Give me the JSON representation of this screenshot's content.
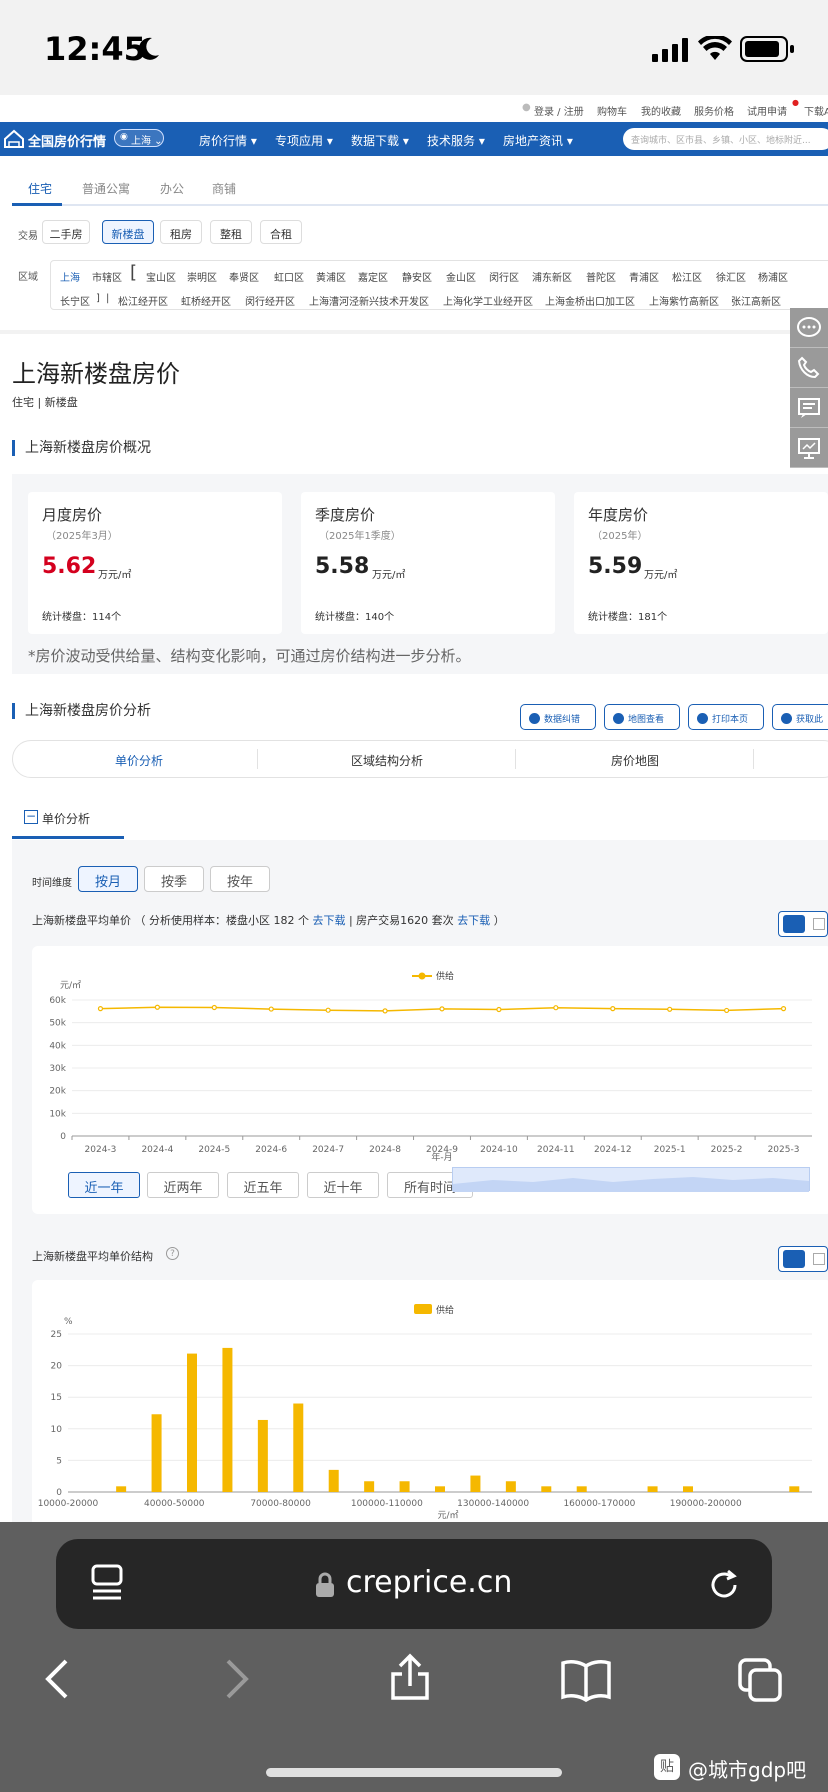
{
  "status_bar": {
    "time": "12:45"
  },
  "top_links": [
    "登录 / 注册",
    "购物车",
    "我的收藏",
    "服务价格",
    "试用申请",
    "下载A"
  ],
  "nav": {
    "logo": "全国房价行情",
    "city": "上海",
    "items": [
      "房价行情",
      "专项应用",
      "数据下载",
      "技术服务",
      "房地产资讯"
    ],
    "search_placeholder": "查询城市、区市县、乡镇、小区、地标附近..."
  },
  "property_tabs": [
    "住宅",
    "普通公寓",
    "办公",
    "商铺"
  ],
  "trade": {
    "label": "交易",
    "options": [
      "二手房",
      "新楼盘",
      "租房",
      "整租",
      "合租"
    ],
    "active": "新楼盘"
  },
  "region": {
    "label": "区域",
    "row1": [
      "上海",
      "市辖区",
      "[",
      "宝山区",
      "崇明区",
      "奉贤区",
      "虹口区",
      "黄浦区",
      "嘉定区",
      "静安区",
      "金山区",
      "闵行区",
      "浦东新区",
      "普陀区",
      "青浦区",
      "松江区",
      "徐汇区",
      "杨浦区"
    ],
    "row2": [
      "长宁区",
      "]",
      "|",
      "松江经开区",
      "虹桥经开区",
      "闵行经开区",
      "上海漕河泾新兴技术开发区",
      "上海化学工业经开区",
      "上海金桥出口加工区",
      "上海紫竹高新区",
      "张江高新区"
    ]
  },
  "page": {
    "title": "上海新楼盘房价",
    "crumb": "住宅 | 新楼盘"
  },
  "overview": {
    "title": "上海新楼盘房价概况",
    "cards": [
      {
        "title": "月度房价",
        "period": "（2025年3月）",
        "value": "5.62",
        "unit": "万元/㎡",
        "count": "统计楼盘：114个",
        "color": "#d4001e"
      },
      {
        "title": "季度房价",
        "period": "（2025年1季度）",
        "value": "5.58",
        "unit": "万元/㎡",
        "count": "统计楼盘：140个",
        "color": "#222222"
      },
      {
        "title": "年度房价",
        "period": "（2025年）",
        "value": "5.59",
        "unit": "万元/㎡",
        "count": "统计楼盘：181个",
        "color": "#222222"
      }
    ],
    "note": "*房价波动受供给量、结构变化影响，可通过房价结构进一步分析。"
  },
  "analysis": {
    "title": "上海新楼盘房价分析",
    "buttons": [
      "数据纠错",
      "地图查看",
      "打印本页",
      "获取此"
    ],
    "segments": [
      "单价分析",
      "区域结构分析",
      "房价地图"
    ],
    "sub_title": "单价分析",
    "time_label": "时间维度",
    "time_options": [
      "按月",
      "按季",
      "按年"
    ],
    "avg_caption": {
      "pre": "上海新楼盘平均单价 （ 分析使用样本：楼盘小区 182 个",
      "link1": "去下载",
      "mid": "| 房产交易1620 套次",
      "link2": "去下载",
      "post": "）"
    },
    "range_options": [
      "近一年",
      "近两年",
      "近五年",
      "近十年",
      "所有时间"
    ],
    "struct_caption": "上海新楼盘平均单价结构"
  },
  "chart_data": [
    {
      "type": "line",
      "ylabel": "元/㎡",
      "xlabel": "年-月",
      "legend": "供给",
      "legend_position": "top-center",
      "grid": true,
      "ylim": [
        0,
        60000
      ],
      "yticks": [
        "0",
        "10k",
        "20k",
        "30k",
        "40k",
        "50k",
        "60k"
      ],
      "categories": [
        "2024-3",
        "2024-4",
        "2024-5",
        "2024-6",
        "2024-7",
        "2024-8",
        "2024-9",
        "2024-10",
        "2024-11",
        "2024-12",
        "2025-1",
        "2025-2",
        "2025-3"
      ],
      "series": [
        {
          "name": "供给",
          "values": [
            56200,
            56800,
            56700,
            56000,
            55500,
            55200,
            56100,
            55800,
            56600,
            56200,
            55900,
            55400,
            56200
          ]
        }
      ],
      "color": "#f5b800"
    },
    {
      "type": "bar",
      "ylabel": "%",
      "xlabel": "元/㎡",
      "legend": "供给",
      "legend_position": "top-center",
      "grid": true,
      "ylim": [
        0,
        25
      ],
      "yticks": [
        "0",
        "5",
        "10",
        "15",
        "20",
        "25"
      ],
      "xtick_labels": [
        "10000-20000",
        "40000-50000",
        "70000-80000",
        "100000-110000",
        "130000-140000",
        "160000-170000",
        "190000-200000"
      ],
      "values": [
        0,
        0.9,
        12.3,
        21.9,
        22.8,
        11.4,
        14.0,
        3.5,
        1.7,
        1.7,
        0.9,
        2.6,
        1.7,
        0.9,
        0.9,
        0,
        0.9,
        0.9,
        0,
        0,
        0.9
      ],
      "series": [
        {
          "name": "供给"
        }
      ],
      "color": "#f5b800"
    }
  ],
  "browser": {
    "url": "creprice.cn"
  },
  "watermark": "@城市gdp吧"
}
